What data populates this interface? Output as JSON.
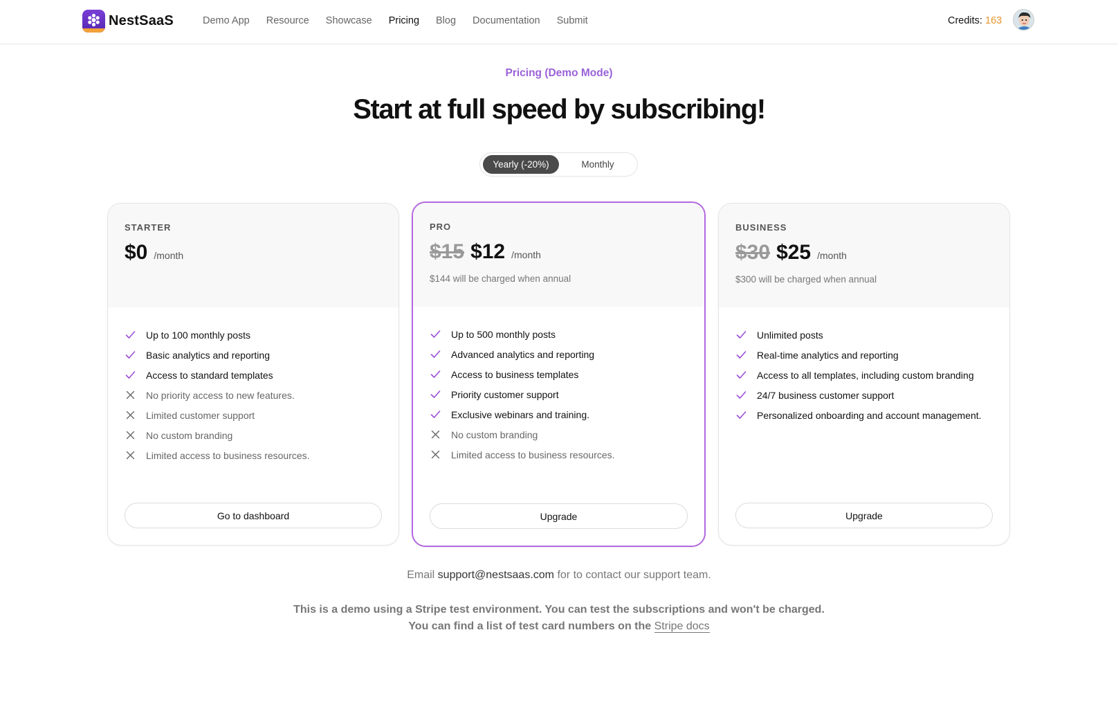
{
  "header": {
    "logo_text": "NestSaaS",
    "nav": [
      {
        "label": "Demo App"
      },
      {
        "label": "Resource"
      },
      {
        "label": "Showcase"
      },
      {
        "label": "Pricing",
        "active": true
      },
      {
        "label": "Blog"
      },
      {
        "label": "Documentation"
      },
      {
        "label": "Submit"
      }
    ],
    "credits_label": "Credits:",
    "credits_value": "163",
    "credits_color": "#e8952f"
  },
  "hero": {
    "eyebrow": "Pricing (Demo Mode)",
    "headline": "Start at full speed by subscribing!",
    "toggle": {
      "yearly": "Yearly (-20%)",
      "monthly": "Monthly",
      "selected": "yearly"
    }
  },
  "plans": [
    {
      "name": "STARTER",
      "old_price": "",
      "price": "$0",
      "per": "/month",
      "annual_note": "",
      "features": [
        {
          "text": "Up to 100 monthly posts",
          "included": true
        },
        {
          "text": "Basic analytics and reporting",
          "included": true
        },
        {
          "text": "Access to standard templates",
          "included": true
        },
        {
          "text": "No priority access to new features.",
          "included": false
        },
        {
          "text": "Limited customer support",
          "included": false
        },
        {
          "text": "No custom branding",
          "included": false
        },
        {
          "text": "Limited access to business resources.",
          "included": false
        }
      ],
      "button": "Go to dashboard"
    },
    {
      "name": "PRO",
      "old_price": "$15",
      "price": "$12",
      "per": "/month",
      "annual_note": "$144 will be charged when annual",
      "features": [
        {
          "text": "Up to 500 monthly posts",
          "included": true
        },
        {
          "text": "Advanced analytics and reporting",
          "included": true
        },
        {
          "text": "Access to business templates",
          "included": true
        },
        {
          "text": "Priority customer support",
          "included": true
        },
        {
          "text": "Exclusive webinars and training.",
          "included": true
        },
        {
          "text": "No custom branding",
          "included": false
        },
        {
          "text": "Limited access to business resources.",
          "included": false
        }
      ],
      "button": "Upgrade"
    },
    {
      "name": "BUSINESS",
      "old_price": "$30",
      "price": "$25",
      "per": "/month",
      "annual_note": "$300 will be charged when annual",
      "features": [
        {
          "text": "Unlimited posts",
          "included": true
        },
        {
          "text": "Real-time analytics and reporting",
          "included": true
        },
        {
          "text": "Access to all templates, including custom branding",
          "included": true
        },
        {
          "text": "24/7 business customer support",
          "included": true
        },
        {
          "text": "Personalized onboarding and account management.",
          "included": true
        }
      ],
      "button": "Upgrade"
    }
  ],
  "footer": {
    "contact_prefix": "Email",
    "contact_email": "support@nestsaas.com",
    "contact_suffix": "for to contact our support team.",
    "demo_line1": "This is a demo using a Stripe test environment. You can test the subscriptions and won't be charged.",
    "demo_line2": "You can find a list of test card numbers on the",
    "stripe_link": "Stripe docs"
  },
  "colors": {
    "accent": "#9a62d8",
    "pro_border": "#b368e0",
    "check": "#9b4fd6"
  }
}
